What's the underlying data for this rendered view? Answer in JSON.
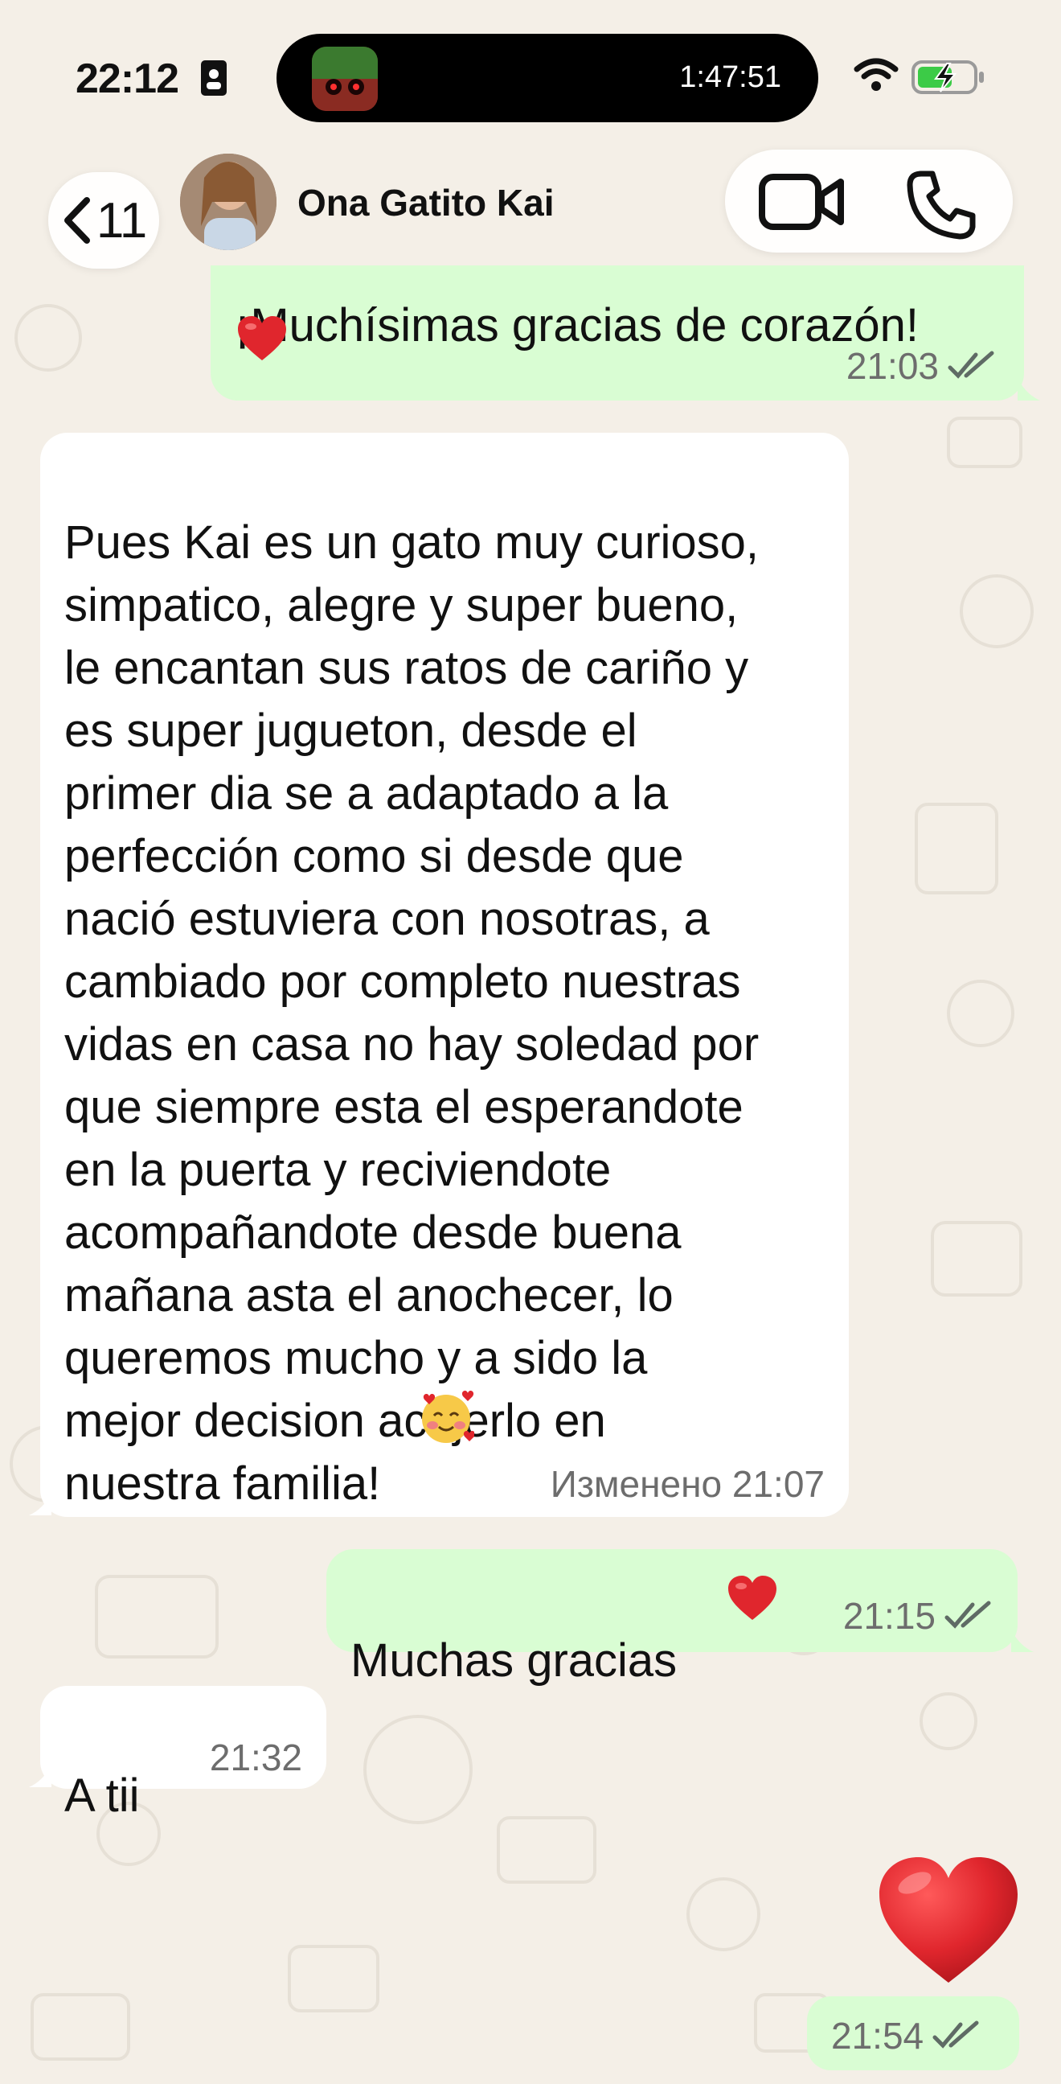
{
  "status_bar": {
    "time": "22:12",
    "timer": "1:47:51"
  },
  "header": {
    "back_count": "11",
    "contact_name": "Ona Gatito Kai"
  },
  "messages": [
    {
      "direction": "outgoing",
      "text": "¡Muchísimas gracias de corazón!",
      "has_heart": true,
      "time": "21:03",
      "read": true
    },
    {
      "direction": "incoming",
      "text": "Pues Kai es un gato muy curioso,\nsimpatico, alegre y super bueno,\nle encantan sus ratos de cariño y\nes super jugueton, desde el\nprimer dia se a adaptado a la\nperfección como si desde que\nnació estuviera con nosotras, a\ncambiado por completo nuestras\nvidas en casa no hay soledad por\nque siempre esta el esperandote\nen la puerta y reciviendote\nacompañandote desde buena\nmañana asta el anochecer, lo\nqueremos mucho y a sido la\nmejor decision acojerlo en\nnuestra familia!",
      "edited_label": "Изменено",
      "time": "21:07"
    },
    {
      "direction": "outgoing",
      "text": "Muchas gracias",
      "has_heart": true,
      "time": "21:15",
      "read": true
    },
    {
      "direction": "incoming",
      "text": "A tii",
      "time": "21:32"
    },
    {
      "direction": "outgoing",
      "type": "emoji",
      "emoji": "red-heart",
      "time": "21:54",
      "read": true
    }
  ],
  "colors": {
    "background": "#f4efe7",
    "outgoing_bubble": "#d9fdd3",
    "incoming_bubble": "#ffffff",
    "read_check": "#5f6b65",
    "heart": "#e0262d"
  }
}
